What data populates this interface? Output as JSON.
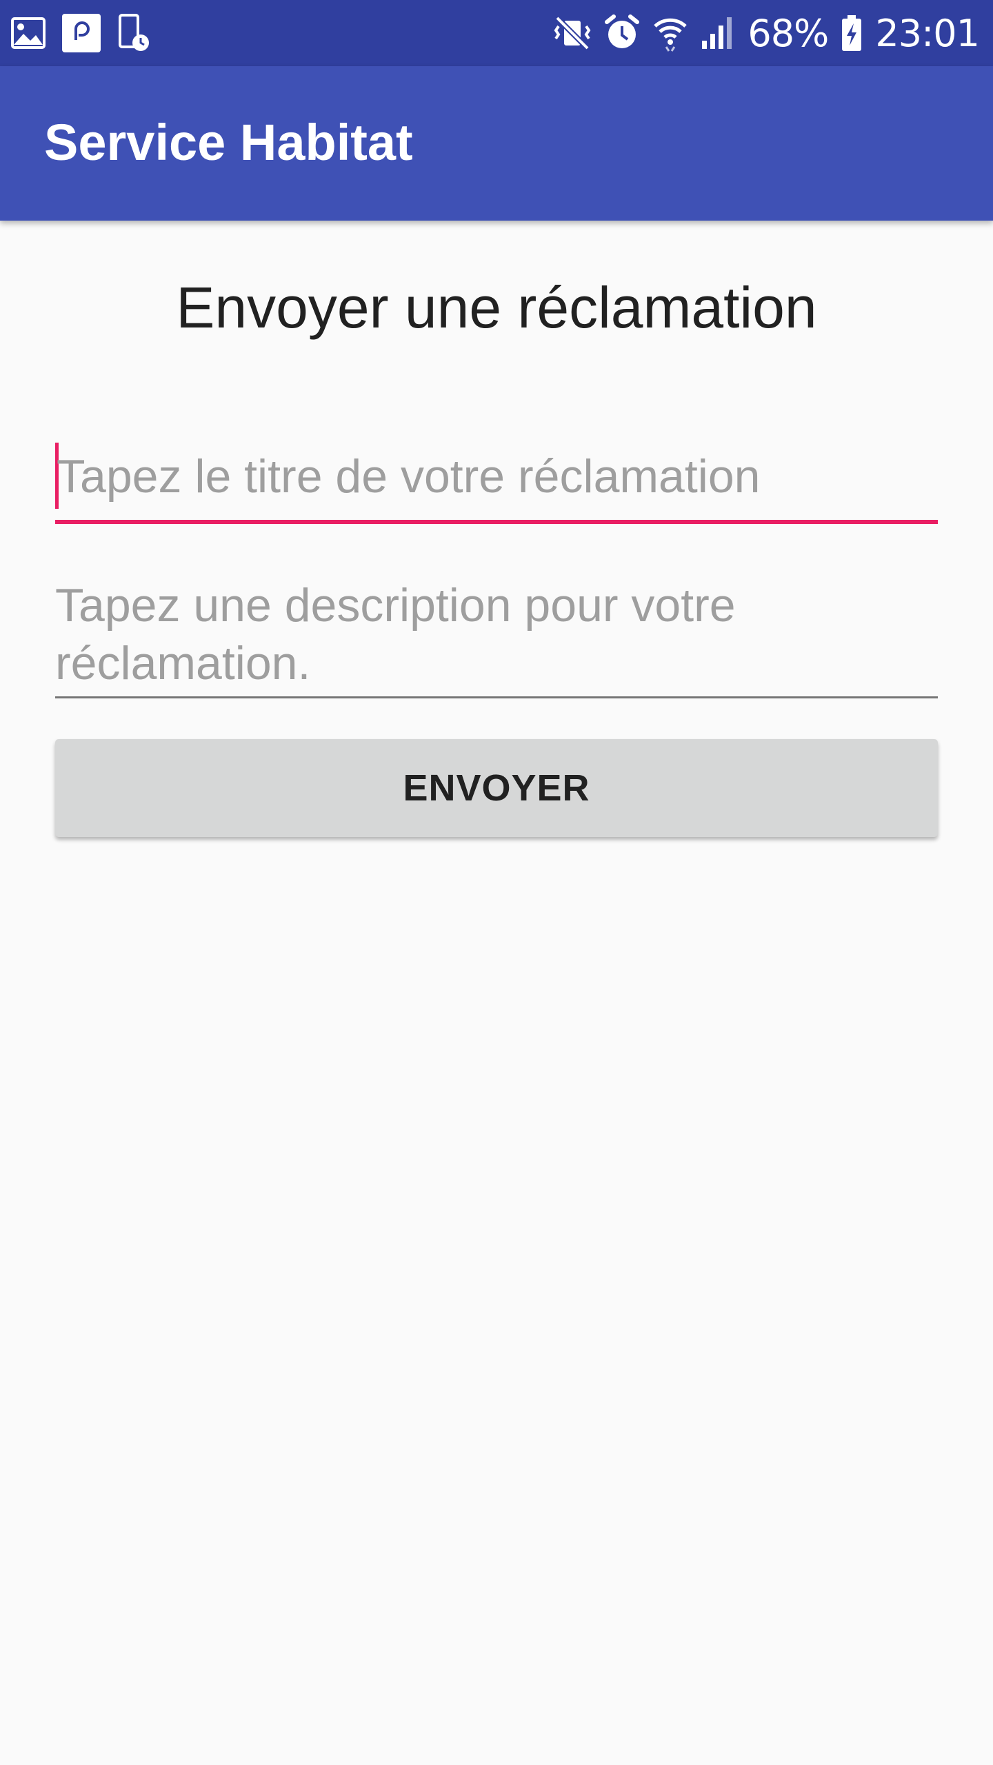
{
  "status_bar": {
    "battery_percent": "68%",
    "time": "23:01",
    "left_icons": [
      "image-icon",
      "chat-app-icon",
      "screen-time-icon"
    ],
    "right_icons": [
      "vibrate-mute-icon",
      "alarm-icon",
      "wifi-icon",
      "cell-signal-icon",
      "battery-charging-icon"
    ]
  },
  "app_bar": {
    "title": "Service Habitat"
  },
  "form": {
    "heading": "Envoyer une réclamation",
    "title_placeholder": "Tapez le titre de votre réclamation",
    "description_placeholder": "Tapez une description pour votre réclamation.",
    "submit_label": "ENVOYER"
  },
  "colors": {
    "status_bar": "#303f9f",
    "app_bar": "#3f51b5",
    "accent": "#e91e63",
    "background": "#fafafa",
    "button": "#d6d7d7"
  }
}
